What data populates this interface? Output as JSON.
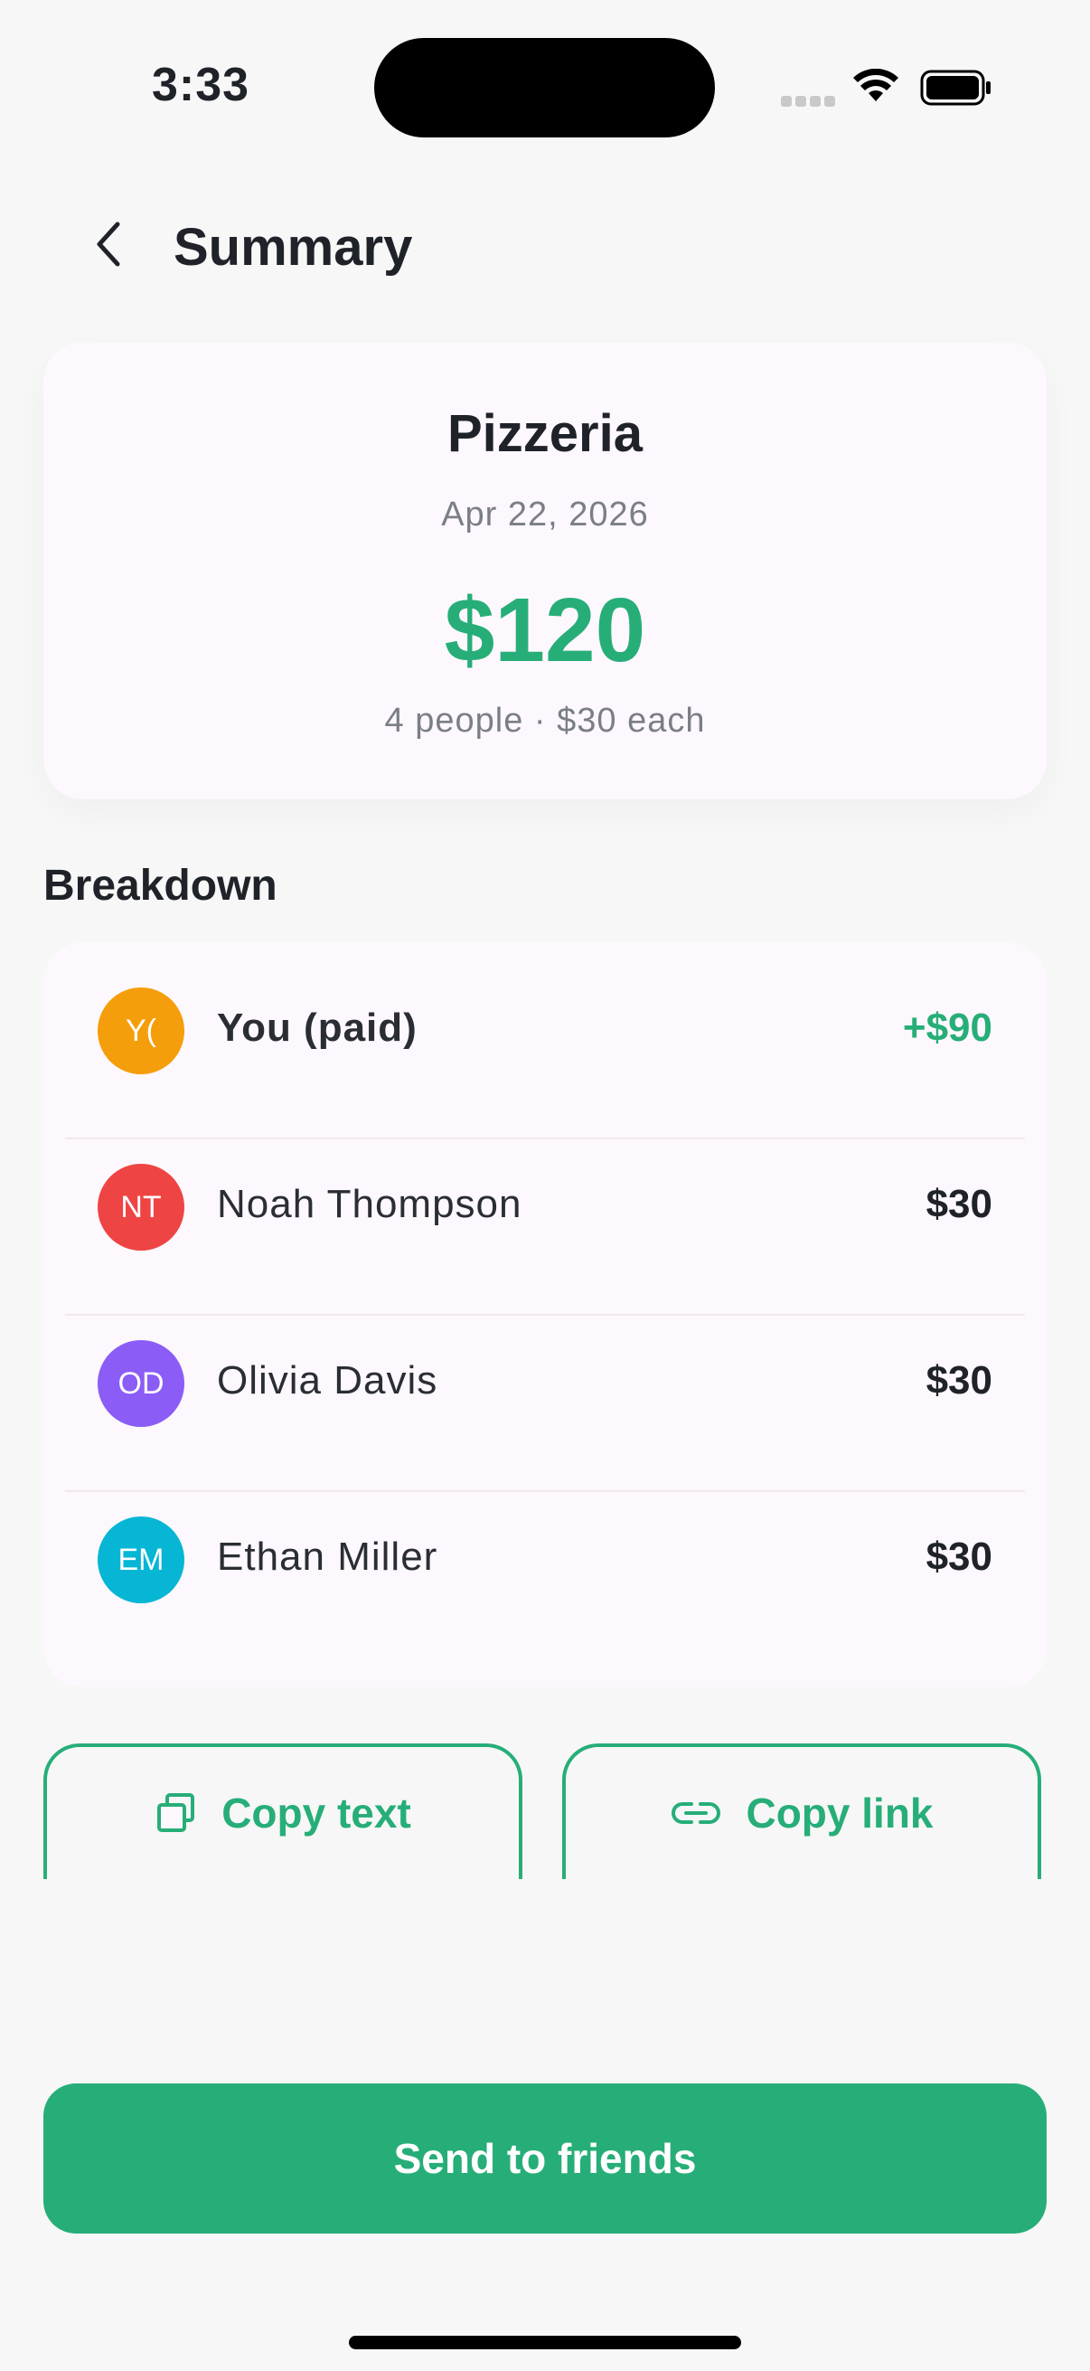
{
  "status_bar": {
    "time": "3:33"
  },
  "nav": {
    "title": "Summary"
  },
  "summary": {
    "merchant": "Pizzeria",
    "date": "Apr 22, 2026",
    "total": "$120",
    "per_person": "4 people · $30 each"
  },
  "breakdown": {
    "title": "Breakdown",
    "rows": [
      {
        "initials": "Y(",
        "name": "You (paid)",
        "amount": "+$90",
        "avatar_color": "#f59e0b"
      },
      {
        "initials": "NT",
        "name": "Noah Thompson",
        "amount": "$30",
        "avatar_color": "#ef4444"
      },
      {
        "initials": "OD",
        "name": "Olivia Davis",
        "amount": "$30",
        "avatar_color": "#8b5cf6"
      },
      {
        "initials": "EM",
        "name": "Ethan Miller",
        "amount": "$30",
        "avatar_color": "#06b6d4"
      }
    ]
  },
  "actions": {
    "copy_text": "Copy text",
    "copy_link": "Copy link",
    "send": "Send to friends"
  },
  "colors": {
    "accent": "#27ae78",
    "card_bg": "#fdf8fd",
    "page_bg": "#f7f7f7"
  },
  "icons": {
    "back": "chevron-left-icon",
    "copy_text": "copy-icon",
    "copy_link": "link-icon",
    "wifi": "wifi-icon",
    "battery": "battery-icon",
    "signal": "signal-icon"
  }
}
